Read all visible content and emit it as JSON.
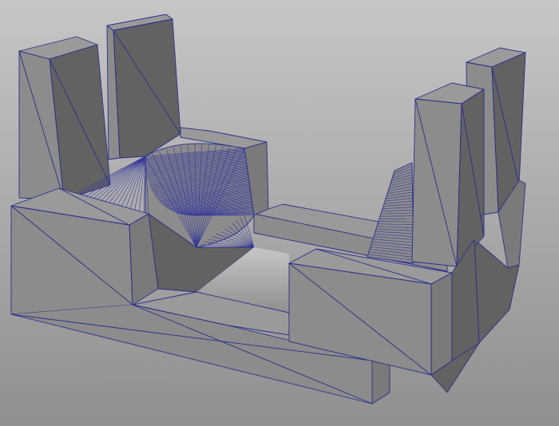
{
  "scene": {
    "kind": "3d-viewport",
    "subject": "wireframe-mesh",
    "colors": {
      "background_top": "#c6c6c6",
      "background_bottom": "#8f8f8f",
      "face_light": "#8c8c8c",
      "face_mid": "#7a7a7a",
      "face_dark": "#626262",
      "face_top": "#9a9a9a",
      "wire": "#2b2f8a"
    }
  }
}
